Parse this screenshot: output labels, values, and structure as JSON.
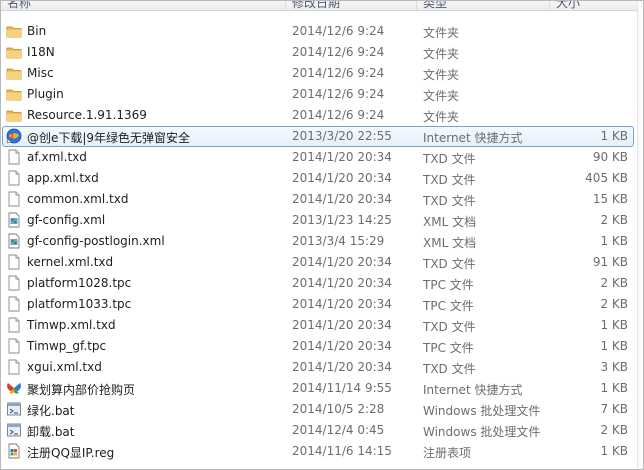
{
  "header": {
    "name": "名称",
    "date": "修改日期",
    "type": "类型",
    "size": "大小"
  },
  "files": [
    {
      "name": "Bin",
      "date": "2014/12/6 9:24",
      "type": "文件夹",
      "size": "",
      "icon": "folder-icon"
    },
    {
      "name": "I18N",
      "date": "2014/12/6 9:24",
      "type": "文件夹",
      "size": "",
      "icon": "folder-icon"
    },
    {
      "name": "Misc",
      "date": "2014/12/6 9:24",
      "type": "文件夹",
      "size": "",
      "icon": "folder-icon"
    },
    {
      "name": "Plugin",
      "date": "2014/12/6 9:24",
      "type": "文件夹",
      "size": "",
      "icon": "folder-icon"
    },
    {
      "name": "Resource.1.91.1369",
      "date": "2014/12/6 9:24",
      "type": "文件夹",
      "size": "",
      "icon": "folder-icon"
    },
    {
      "name": "@创e下载|9年绿色无弹窗安全",
      "date": "2013/3/20 22:55",
      "type": "Internet 快捷方式",
      "size": "1 KB",
      "icon": "internet-shortcut-icon",
      "selected": true
    },
    {
      "name": "af.xml.txd",
      "date": "2014/1/20 20:34",
      "type": "TXD 文件",
      "size": "90 KB",
      "icon": "file-icon"
    },
    {
      "name": "app.xml.txd",
      "date": "2014/1/20 20:34",
      "type": "TXD 文件",
      "size": "405 KB",
      "icon": "file-icon"
    },
    {
      "name": "common.xml.txd",
      "date": "2014/1/20 20:34",
      "type": "TXD 文件",
      "size": "15 KB",
      "icon": "file-icon"
    },
    {
      "name": "gf-config.xml",
      "date": "2013/1/23 14:25",
      "type": "XML 文档",
      "size": "2 KB",
      "icon": "xml-document-icon"
    },
    {
      "name": "gf-config-postlogin.xml",
      "date": "2013/3/4 15:29",
      "type": "XML 文档",
      "size": "1 KB",
      "icon": "xml-document-icon"
    },
    {
      "name": "kernel.xml.txd",
      "date": "2014/1/20 20:34",
      "type": "TXD 文件",
      "size": "91 KB",
      "icon": "file-icon"
    },
    {
      "name": "platform1028.tpc",
      "date": "2014/1/20 20:34",
      "type": "TPC 文件",
      "size": "2 KB",
      "icon": "file-icon"
    },
    {
      "name": "platform1033.tpc",
      "date": "2014/1/20 20:34",
      "type": "TPC 文件",
      "size": "2 KB",
      "icon": "file-icon"
    },
    {
      "name": "Timwp.xml.txd",
      "date": "2014/1/20 20:34",
      "type": "TXD 文件",
      "size": "1 KB",
      "icon": "file-icon"
    },
    {
      "name": "Timwp_gf.tpc",
      "date": "2014/1/20 20:34",
      "type": "TPC 文件",
      "size": "1 KB",
      "icon": "file-icon"
    },
    {
      "name": "xgui.xml.txd",
      "date": "2014/1/20 20:34",
      "type": "TXD 文件",
      "size": "3 KB",
      "icon": "file-icon"
    },
    {
      "name": "聚划算内部价抢购页",
      "date": "2014/11/14 9:55",
      "type": "Internet 快捷方式",
      "size": "1 KB",
      "icon": "butterfly-shortcut-icon"
    },
    {
      "name": "绿化.bat",
      "date": "2014/10/5 2:28",
      "type": "Windows 批处理文件",
      "size": "7 KB",
      "icon": "batch-file-icon"
    },
    {
      "name": "卸载.bat",
      "date": "2014/12/4 0:45",
      "type": "Windows 批处理文件",
      "size": "2 KB",
      "icon": "batch-file-icon"
    },
    {
      "name": "注册QQ显IP.reg",
      "date": "2014/11/6 14:15",
      "type": "注册表项",
      "size": "1 KB",
      "icon": "registry-file-icon"
    }
  ]
}
